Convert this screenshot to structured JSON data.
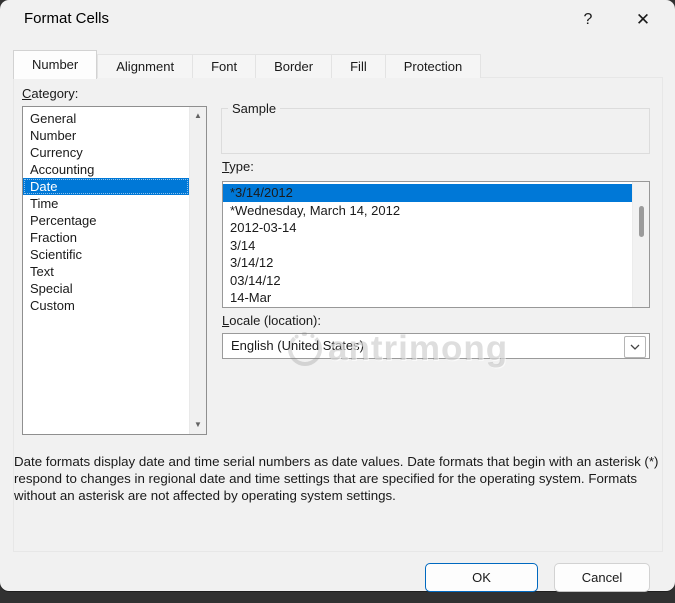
{
  "window": {
    "title": "Format Cells",
    "help_glyph": "?",
    "close_glyph": "✕"
  },
  "tabs": {
    "selected": "Number",
    "items": [
      {
        "label": "Number"
      },
      {
        "label": "Alignment"
      },
      {
        "label": "Font"
      },
      {
        "label": "Border"
      },
      {
        "label": "Fill"
      },
      {
        "label": "Protection"
      }
    ]
  },
  "number_tab": {
    "category": {
      "label_key": "C",
      "label_rest": "ategory:",
      "selected": "Date",
      "items": [
        "General",
        "Number",
        "Currency",
        "Accounting",
        "Date",
        "Time",
        "Percentage",
        "Fraction",
        "Scientific",
        "Text",
        "Special",
        "Custom"
      ]
    },
    "sample": {
      "legend": "Sample",
      "value": ""
    },
    "type": {
      "label_key": "T",
      "label_rest": "ype:",
      "selected": "*3/14/2012",
      "items": [
        "*3/14/2012",
        "*Wednesday, March 14, 2012",
        "2012-03-14",
        "3/14",
        "3/14/12",
        "03/14/12",
        "14-Mar"
      ]
    },
    "locale": {
      "label_key": "L",
      "label_rest": "ocale (location):",
      "value": "English (United States)"
    },
    "description": "Date formats display date and time serial numbers as date values.  Date formats that begin with an asterisk (*) respond to changes in regional date and time settings that are specified for the operating system. Formats without an asterisk are not affected by operating system settings."
  },
  "buttons": {
    "ok": "OK",
    "cancel": "Cancel"
  },
  "watermark": {
    "text": "antrimong"
  },
  "icons": {
    "scroll_up": "▲",
    "scroll_down": "▼"
  },
  "colors": {
    "accent": "#0078d7",
    "dialog_bg": "#f1f1f1",
    "outside_bg": "#313131",
    "ok_border": "#0069c0"
  }
}
